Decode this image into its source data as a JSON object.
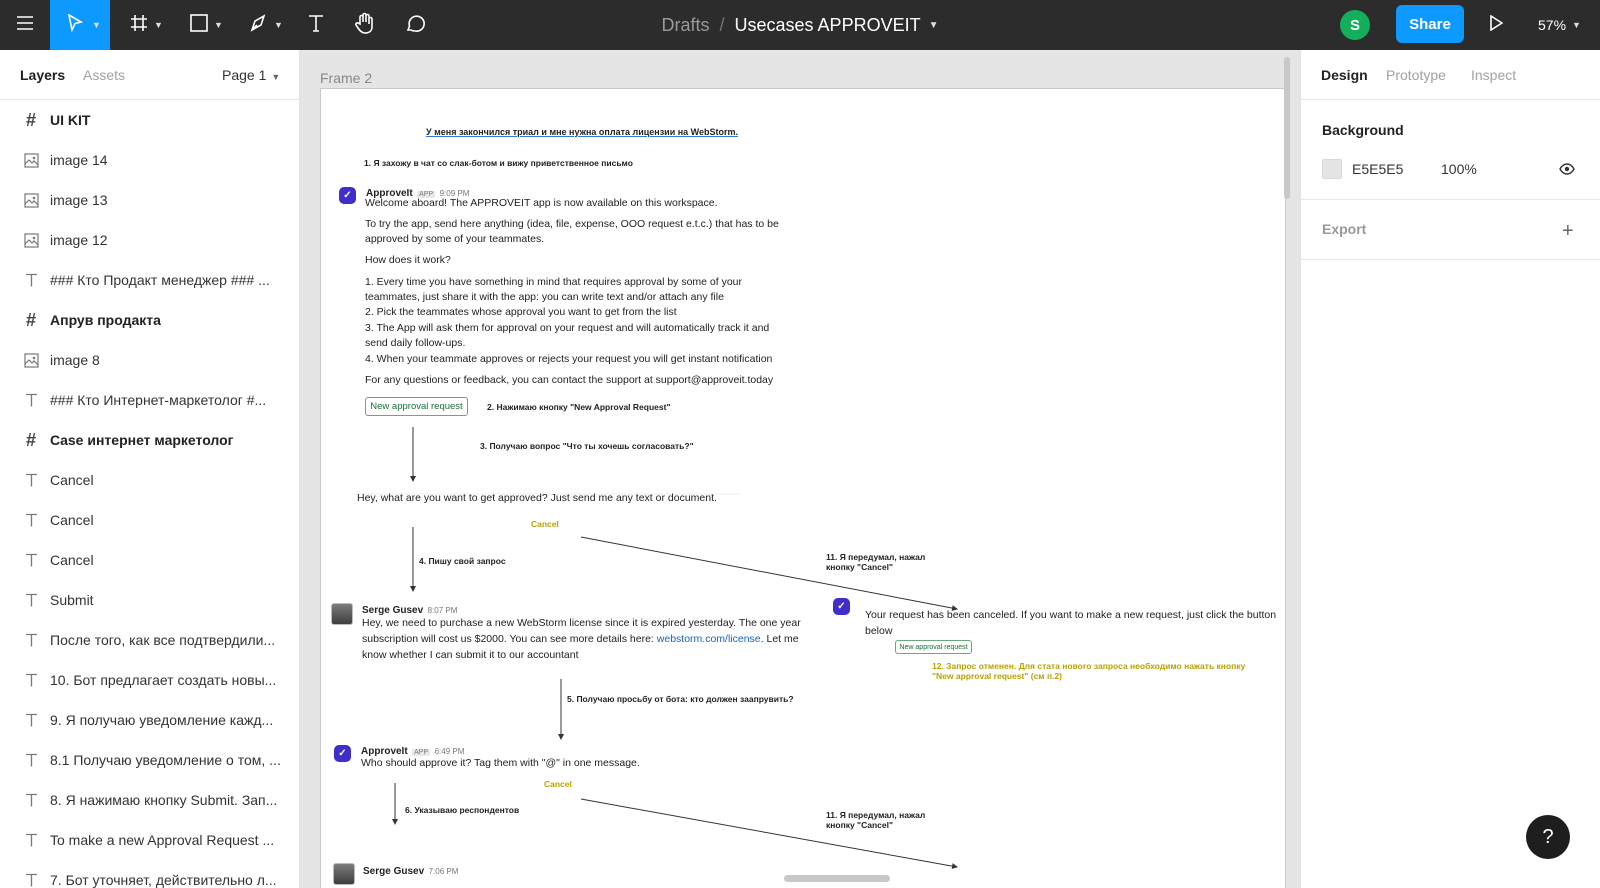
{
  "toolbar": {
    "breadcrumb_folder": "Drafts",
    "breadcrumb_sep": "/",
    "file_name": "Usecases APPROVEIT",
    "avatar_initial": "S",
    "share_label": "Share",
    "zoom_level": "57%"
  },
  "left_panel": {
    "tabs": {
      "layers": "Layers",
      "assets": "Assets"
    },
    "page_selector": "Page 1",
    "layers": [
      {
        "type": "frame",
        "label": "UI KIT"
      },
      {
        "type": "image",
        "label": "image 14"
      },
      {
        "type": "image",
        "label": "image 13"
      },
      {
        "type": "image",
        "label": "image 12"
      },
      {
        "type": "text",
        "label": "### Кто Продакт менеджер ### ..."
      },
      {
        "type": "frame",
        "label": "Апрув продакта"
      },
      {
        "type": "image",
        "label": "image 8"
      },
      {
        "type": "text",
        "label": "### Кто Интернет-маркетолог #..."
      },
      {
        "type": "frame",
        "label": "Case интернет маркетолог"
      },
      {
        "type": "text",
        "label": "Cancel"
      },
      {
        "type": "text",
        "label": "Cancel"
      },
      {
        "type": "text",
        "label": "Cancel"
      },
      {
        "type": "text",
        "label": "Submit"
      },
      {
        "type": "text",
        "label": "После того, как все подтвердили..."
      },
      {
        "type": "text",
        "label": "10. Бот предлагает создать новы..."
      },
      {
        "type": "text",
        "label": "9. Я получаю уведомление кажд..."
      },
      {
        "type": "text",
        "label": "8.1 Получаю уведомление о том, ..."
      },
      {
        "type": "text",
        "label": "8. Я нажимаю кнопку Submit. Зап..."
      },
      {
        "type": "text",
        "label": "To make a new Approval Request ..."
      },
      {
        "type": "text",
        "label": "7. Бот уточняет, действительно л..."
      }
    ]
  },
  "right_panel": {
    "tabs": {
      "design": "Design",
      "prototype": "Prototype",
      "inspect": "Inspect"
    },
    "background_heading": "Background",
    "background_hex": "E5E5E5",
    "background_opacity": "100%",
    "export_heading": "Export"
  },
  "canvas": {
    "frame_name": "Frame 2",
    "heading": "У меня закончился триал и мне нужна оплата лицензии на WebStorm.",
    "step1": "1. Я захожу в чат со слак-ботом и вижу приветственное письмо",
    "bot_name": "ApproveIt",
    "app_badge": "APP",
    "welcome_time": "9:09 PM",
    "welcome_lines": [
      "Welcome aboard! The APPROVEIT app is now available on this workspace.",
      "To try the app, send here anything (idea, file, expense, OOO request e.t.c.) that has to be",
      "approved by some of your teammates.",
      "How does it work?",
      "1. Every time you have something in mind that requires approval by some of your",
      "teammates, just share it with the app: you can write text and/or attach any file",
      "2. Pick the teammates whose approval you want to get from the list",
      "3. The App will ask them for approval on your request and will automatically track it and",
      "send daily follow-ups.",
      "4. When your teammate approves or rejects your request you will get instant notification",
      "For any questions or feedback, you can contact the support at support@approveit.today"
    ],
    "new_request_btn": "New approval request",
    "step2": "2. Нажимаю кнопку \"New Approval Request\"",
    "step3": "3. Получаю вопрос \"Что ты хочешь согласовать?\"",
    "question": "Hey, what are you want to get approved? Just send me any text or document.",
    "cancel": "Cancel",
    "step4": "4. Пишу свой запрос",
    "step11_line1": "11. Я передумал, нажал",
    "step11_line2": "кнопку \"Cancel\"",
    "user_name": "Serge Gusev",
    "user_time": "8:07 PM",
    "user_msg_line1": "Hey, we need to purchase a new WebStorm license since it is expired yesterday. The one year",
    "user_msg_line2a": "subscription will cost us $2000. You can see more details here: ",
    "user_msg_link": "webstorm.com/license",
    "user_msg_line2b": ". Let me",
    "user_msg_line3": "know whether I can submit it to our accountant",
    "canceled_line1": "Your request has been canceled. If you want to make a new request, just click the button",
    "canceled_line2": "below",
    "new_request_btn_small": "New approval request",
    "step12_line1": "12. Запрос отменен. Для стата нового запроса необходимо нажать кнопку",
    "step12_line2": "\"New approval request\" (см п.2)",
    "step5": "5. Получаю просьбу от бота: кто должен заапрувить?",
    "bot_time2": "6:49 PM",
    "who_approve": "Who should approve it? Tag them with \"@\" in one message.",
    "step6": "6. Указываю респондентов",
    "user_time2": "7:06 PM"
  },
  "help": "?"
}
